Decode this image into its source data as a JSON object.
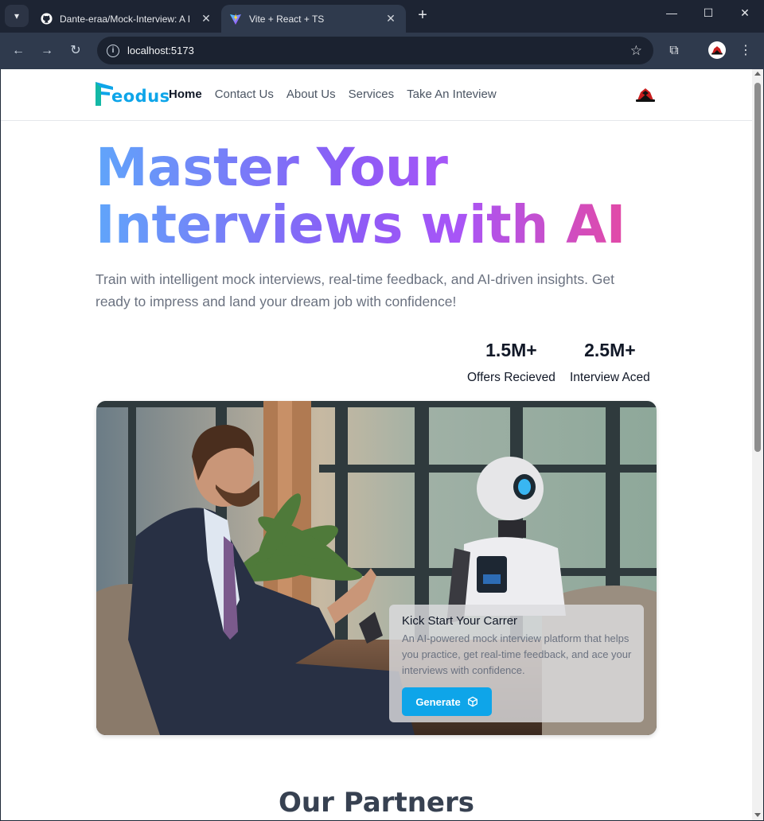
{
  "browser": {
    "tabs": [
      {
        "title": "Dante-eraa/Mock-Interview: A I",
        "icon": "github-icon",
        "active": false
      },
      {
        "title": "Vite + React + TS",
        "icon": "vite-icon",
        "active": true
      }
    ],
    "new_tab": "+",
    "address": "localhost:5173",
    "window_controls": {
      "minimize": "—",
      "maximize": "☐",
      "close": "✕"
    },
    "nav": {
      "back": "←",
      "forward": "→",
      "reload": "↻"
    },
    "star": "☆",
    "extensions": "⧉",
    "menu": "⋮"
  },
  "site": {
    "logo_text": "eodus",
    "nav": [
      {
        "label": "Home",
        "active": true
      },
      {
        "label": "Contact Us",
        "active": false
      },
      {
        "label": "About Us",
        "active": false
      },
      {
        "label": "Services",
        "active": false
      },
      {
        "label": "Take An Inteview",
        "active": false
      }
    ]
  },
  "hero": {
    "title_line1": "Master Your",
    "title_line2": "Interviews with AI",
    "subtitle": "Train with intelligent mock interviews, real-time feedback, and AI-driven insights. Get ready to impress and land your dream job with confidence!",
    "stats": [
      {
        "value": "1.5M+",
        "label": "Offers Recieved"
      },
      {
        "value": "2.5M+",
        "label": "Interview Aced"
      }
    ]
  },
  "card": {
    "title": "Kick Start Your Carrer",
    "text": "An AI-powered mock interview platform that helps you practice, get real-time feedback, and ace your interviews with confidence.",
    "button_label": "Generate",
    "button_icon": "cube-icon"
  },
  "partners": {
    "title": "Our Partners"
  },
  "colors": {
    "accent": "#0ea5e9",
    "gradient": [
      "#60a5fa",
      "#8b5cf6",
      "#ec4899"
    ]
  }
}
